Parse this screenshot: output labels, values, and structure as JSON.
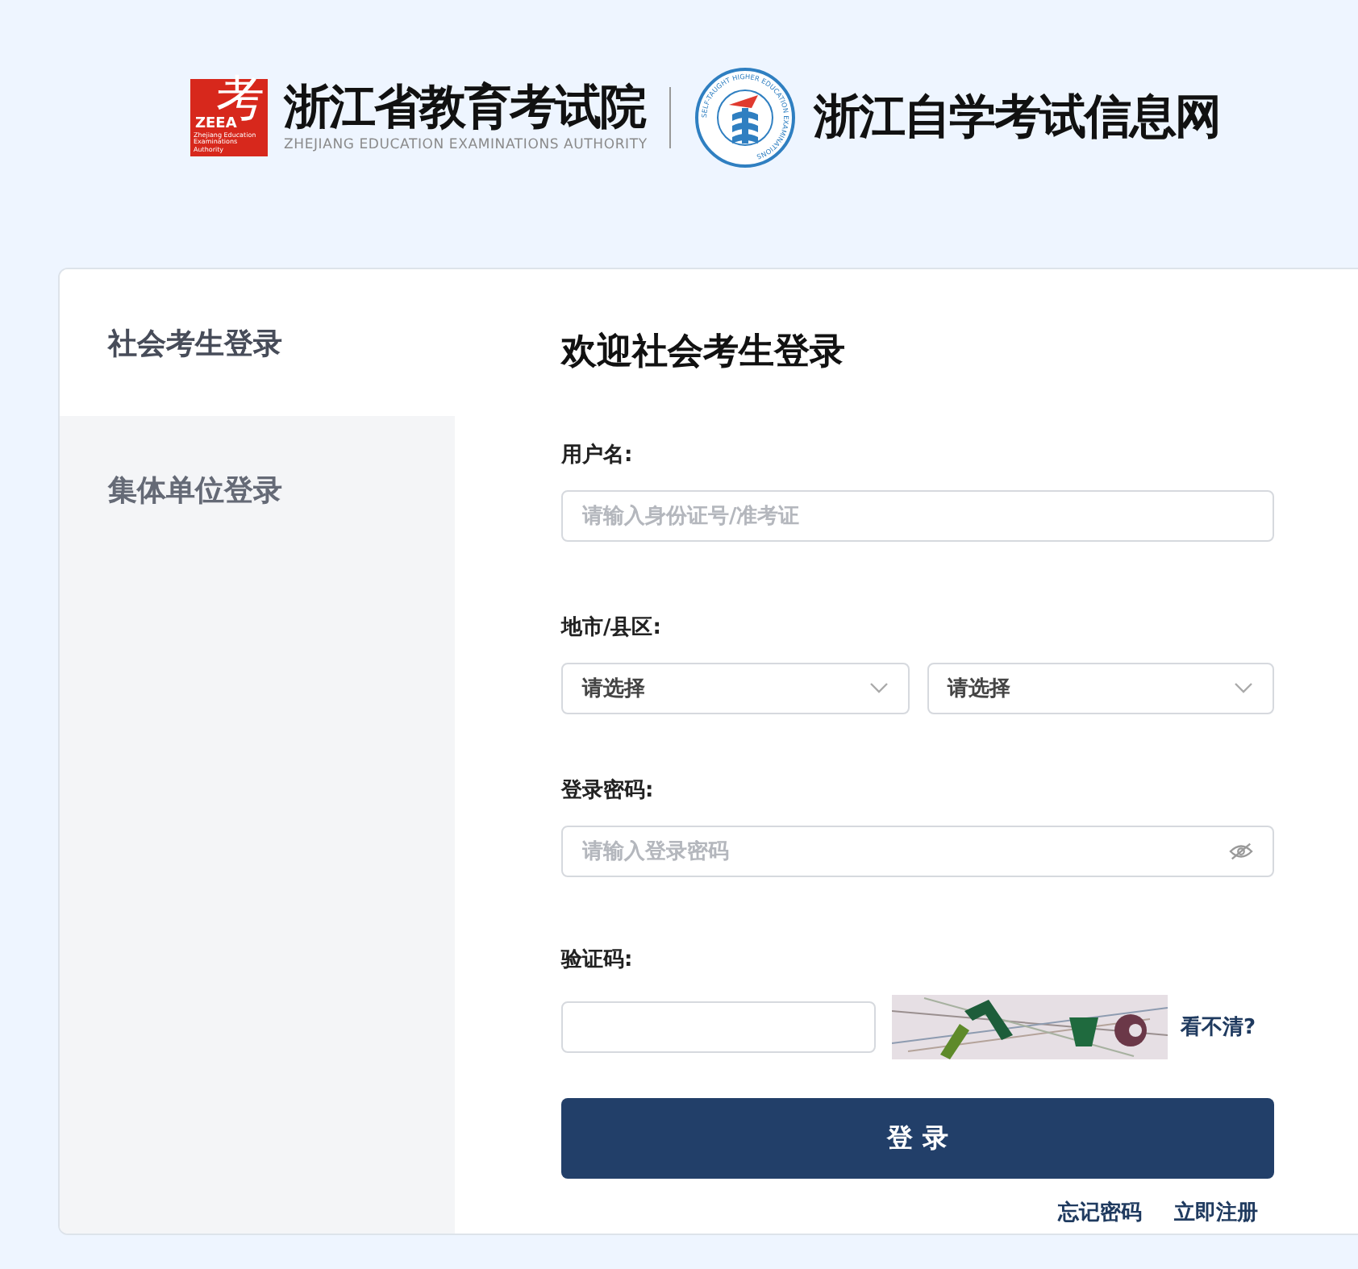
{
  "header": {
    "logo_char": "考",
    "logo_abbr": "ZEEA",
    "logo_small": "Zhejiang Education Examinations Authority",
    "org_name": "浙江省教育考试院",
    "org_name_en": "ZHEJIANG EDUCATION EXAMINATIONS AUTHORITY",
    "emblem_ring": "SELF-TAUGHT HIGHER EDUCATION EXAMINATIONS",
    "site_name": "浙江自学考试信息网"
  },
  "tabs": [
    {
      "label": "社会考生登录",
      "selected": true
    },
    {
      "label": "集体单位登录",
      "selected": false
    }
  ],
  "form": {
    "title": "欢迎社会考生登录",
    "username": {
      "label": "用户名:",
      "placeholder": "请输入身份证号/准考证"
    },
    "region": {
      "label": "地市/县区:",
      "selects": [
        {
          "value": "请选择"
        },
        {
          "value": "请选择"
        }
      ]
    },
    "password": {
      "label": "登录密码:",
      "placeholder": "请输入登录密码"
    },
    "captcha": {
      "label": "验证码:",
      "refresh": "看不清?"
    },
    "submit": "登 录",
    "links": [
      "忘记密码",
      "立即注册"
    ]
  }
}
